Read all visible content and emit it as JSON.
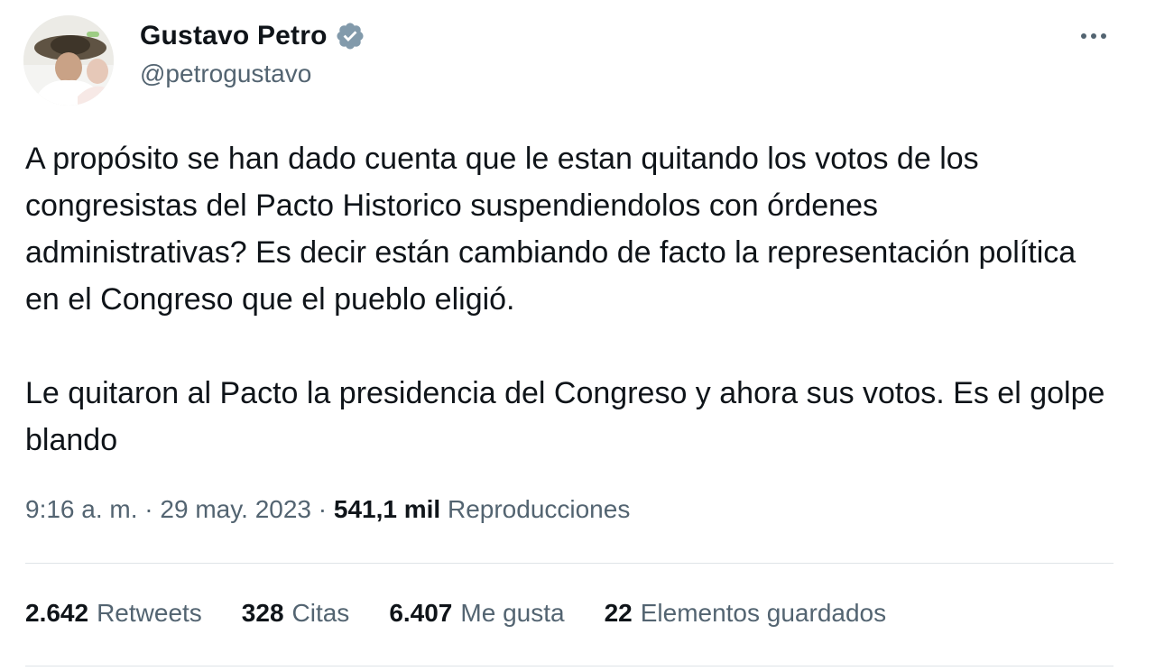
{
  "author": {
    "display_name": "Gustavo Petro",
    "handle": "@petrogustavo"
  },
  "icons": {
    "verified": "verified-badge-icon",
    "more": "more-options-icon",
    "verified_color": "#829aab"
  },
  "tweet": {
    "paragraphs": [
      "A propósito se han dado cuenta que le estan quitando los votos de los congresistas del Pacto Historico suspendiendolos con órdenes administrativas? Es decir están cambiando de facto la representación política en el Congreso que el pueblo eligió.",
      "Le quitaron al Pacto la presidencia del Congreso y ahora sus votos. Es el golpe blando"
    ]
  },
  "meta": {
    "time": "9:16 a. m.",
    "separator": "·",
    "date": "29 may. 2023",
    "views_count": "541,1 mil",
    "views_label": "Reproducciones"
  },
  "stats": {
    "retweets": {
      "count": "2.642",
      "label": "Retweets"
    },
    "quotes": {
      "count": "328",
      "label": "Citas"
    },
    "likes": {
      "count": "6.407",
      "label": "Me gusta"
    },
    "bookmarks": {
      "count": "22",
      "label": "Elementos guardados"
    }
  },
  "colors": {
    "text_primary": "#0f1419",
    "text_secondary": "#536471",
    "divider": "#dfe4e8"
  }
}
